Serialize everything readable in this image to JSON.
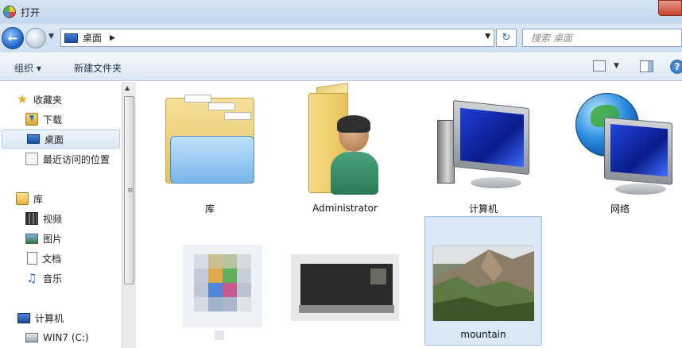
{
  "window": {
    "title": "打开"
  },
  "address_bar": {
    "location": "桌面",
    "search_placeholder": "搜索 桌面"
  },
  "toolbar": {
    "organize_label": "组织 ▾",
    "new_folder_label": "新建文件夹"
  },
  "nav_pane": {
    "favorites": {
      "label": "收藏夹",
      "items": [
        {
          "label": "下载",
          "icon": "download-folder-icon"
        },
        {
          "label": "桌面",
          "icon": "desktop-icon",
          "selected": true
        },
        {
          "label": "最近访问的位置",
          "icon": "recent-places-icon"
        }
      ]
    },
    "libraries": {
      "label": "库",
      "items": [
        {
          "label": "视频",
          "icon": "video-icon"
        },
        {
          "label": "图片",
          "icon": "picture-icon"
        },
        {
          "label": "文档",
          "icon": "document-icon"
        },
        {
          "label": "音乐",
          "icon": "music-icon"
        }
      ]
    },
    "computer": {
      "label": "计算机",
      "items": [
        {
          "label": "WIN7 (C:)",
          "icon": "drive-icon"
        }
      ]
    }
  },
  "content": {
    "items": [
      {
        "label": "库",
        "icon": "libraries-folder-icon"
      },
      {
        "label": "Administrator",
        "icon": "user-folder-icon"
      },
      {
        "label": "计算机",
        "icon": "computer-icon"
      },
      {
        "label": "网络",
        "icon": "network-icon"
      },
      {
        "label": "",
        "icon": "blurred-file-icon"
      },
      {
        "label": "",
        "icon": "blurred-file-icon"
      },
      {
        "label": "mountain",
        "icon": "image-thumbnail",
        "selected": true
      }
    ]
  },
  "colors": {
    "titlebar": "#c9dcf0",
    "selection": "#dbe8f7",
    "accent": "#1c5fbf"
  }
}
